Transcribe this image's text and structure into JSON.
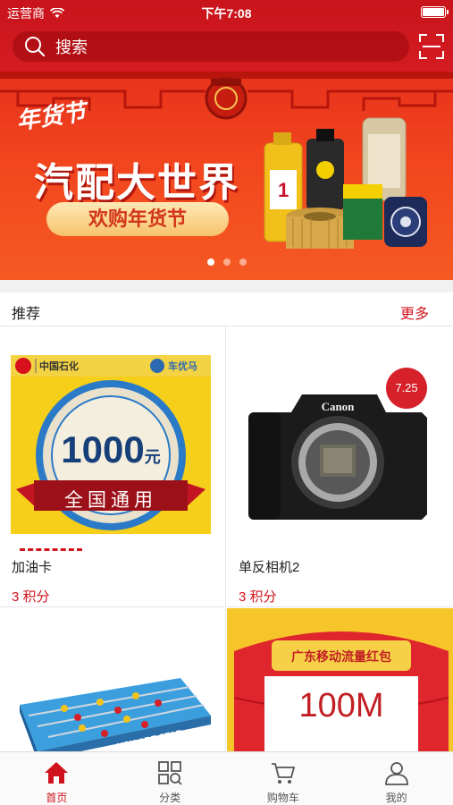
{
  "status_bar": {
    "carrier": "运营商",
    "time": "下午7:08"
  },
  "search": {
    "placeholder": "搜索"
  },
  "banner": {
    "corner_text": "年货节",
    "title": "汽配大世界",
    "subtitle": "欢购年货节",
    "slides": 3,
    "active_slide": 1
  },
  "recommend": {
    "title": "推荐",
    "more": "更多"
  },
  "products": [
    {
      "name": "加油卡",
      "points": "3  积分",
      "brand": "中国石化",
      "partner": "车优马",
      "value": "1000",
      "unit": "元",
      "ribbon": "全国通用"
    },
    {
      "name": "单反相机2",
      "points": "3  积分",
      "badge": "7.25",
      "brand": "Canon"
    },
    {
      "name": "",
      "points": "",
      "banner_text": "YOU ARE STAR"
    },
    {
      "name": "",
      "points": "",
      "title": "广东移动流量红包",
      "value": "100M"
    }
  ],
  "tabs": [
    {
      "label": "首页",
      "icon": "home-icon",
      "active": true
    },
    {
      "label": "分类",
      "icon": "category-icon",
      "active": false
    },
    {
      "label": "购物车",
      "icon": "cart-icon",
      "active": false
    },
    {
      "label": "我的",
      "icon": "user-icon",
      "active": false
    }
  ],
  "colors": {
    "primary": "#d0121c",
    "banner": "#f2461e",
    "gold": "#f6c36b"
  }
}
